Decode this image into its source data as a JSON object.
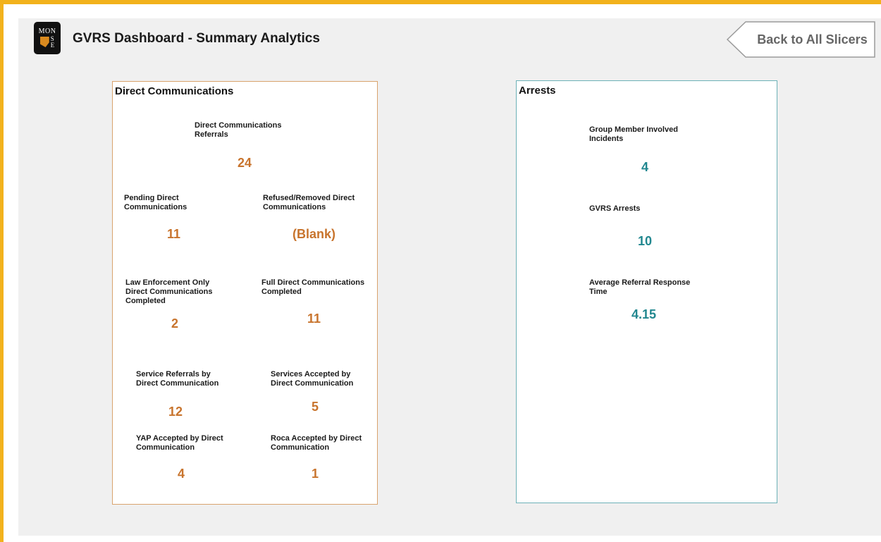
{
  "header": {
    "title": "GVRS Dashboard - Summary Analytics",
    "logo": {
      "line1": "MON",
      "letters": [
        "S",
        "E"
      ],
      "emblem_color": "#d98a1f"
    },
    "back_button": {
      "label": "Back to All Slicers",
      "icon": "arrow-left-shape-icon"
    }
  },
  "colors": {
    "accent_border": "#f2b21c",
    "direct_comm_value": "#c8742d",
    "arrests_value": "#21878f"
  },
  "direct_communications": {
    "title": "Direct Communications",
    "referrals": {
      "label": "Direct Communications Referrals",
      "value": "24"
    },
    "pending": {
      "label": "Pending Direct Communications",
      "value": "11"
    },
    "refused_removed": {
      "label": "Refused/Removed Direct Communications",
      "value": "(Blank)"
    },
    "law_enforcement_only": {
      "label": "Law Enforcement Only Direct Communications Completed",
      "value": "2"
    },
    "full_completed": {
      "label": "Full Direct Communications Completed",
      "value": "11"
    },
    "service_referrals": {
      "label": "Service Referrals by Direct Communication",
      "value": "12"
    },
    "services_accepted": {
      "label": "Services Accepted by Direct Communication",
      "value": "5"
    },
    "yap_accepted": {
      "label": "YAP Accepted by Direct Communication",
      "value": "4"
    },
    "roca_accepted": {
      "label": "Roca Accepted by Direct Communication",
      "value": "1"
    }
  },
  "arrests": {
    "title": "Arrests",
    "group_member_incidents": {
      "label": "Group Member Involved Incidents",
      "value": "4"
    },
    "gvrs_arrests": {
      "label": "GVRS Arrests",
      "value": "10"
    },
    "avg_response_time": {
      "label": "Average Referral Response Time",
      "value": "4.15"
    }
  }
}
